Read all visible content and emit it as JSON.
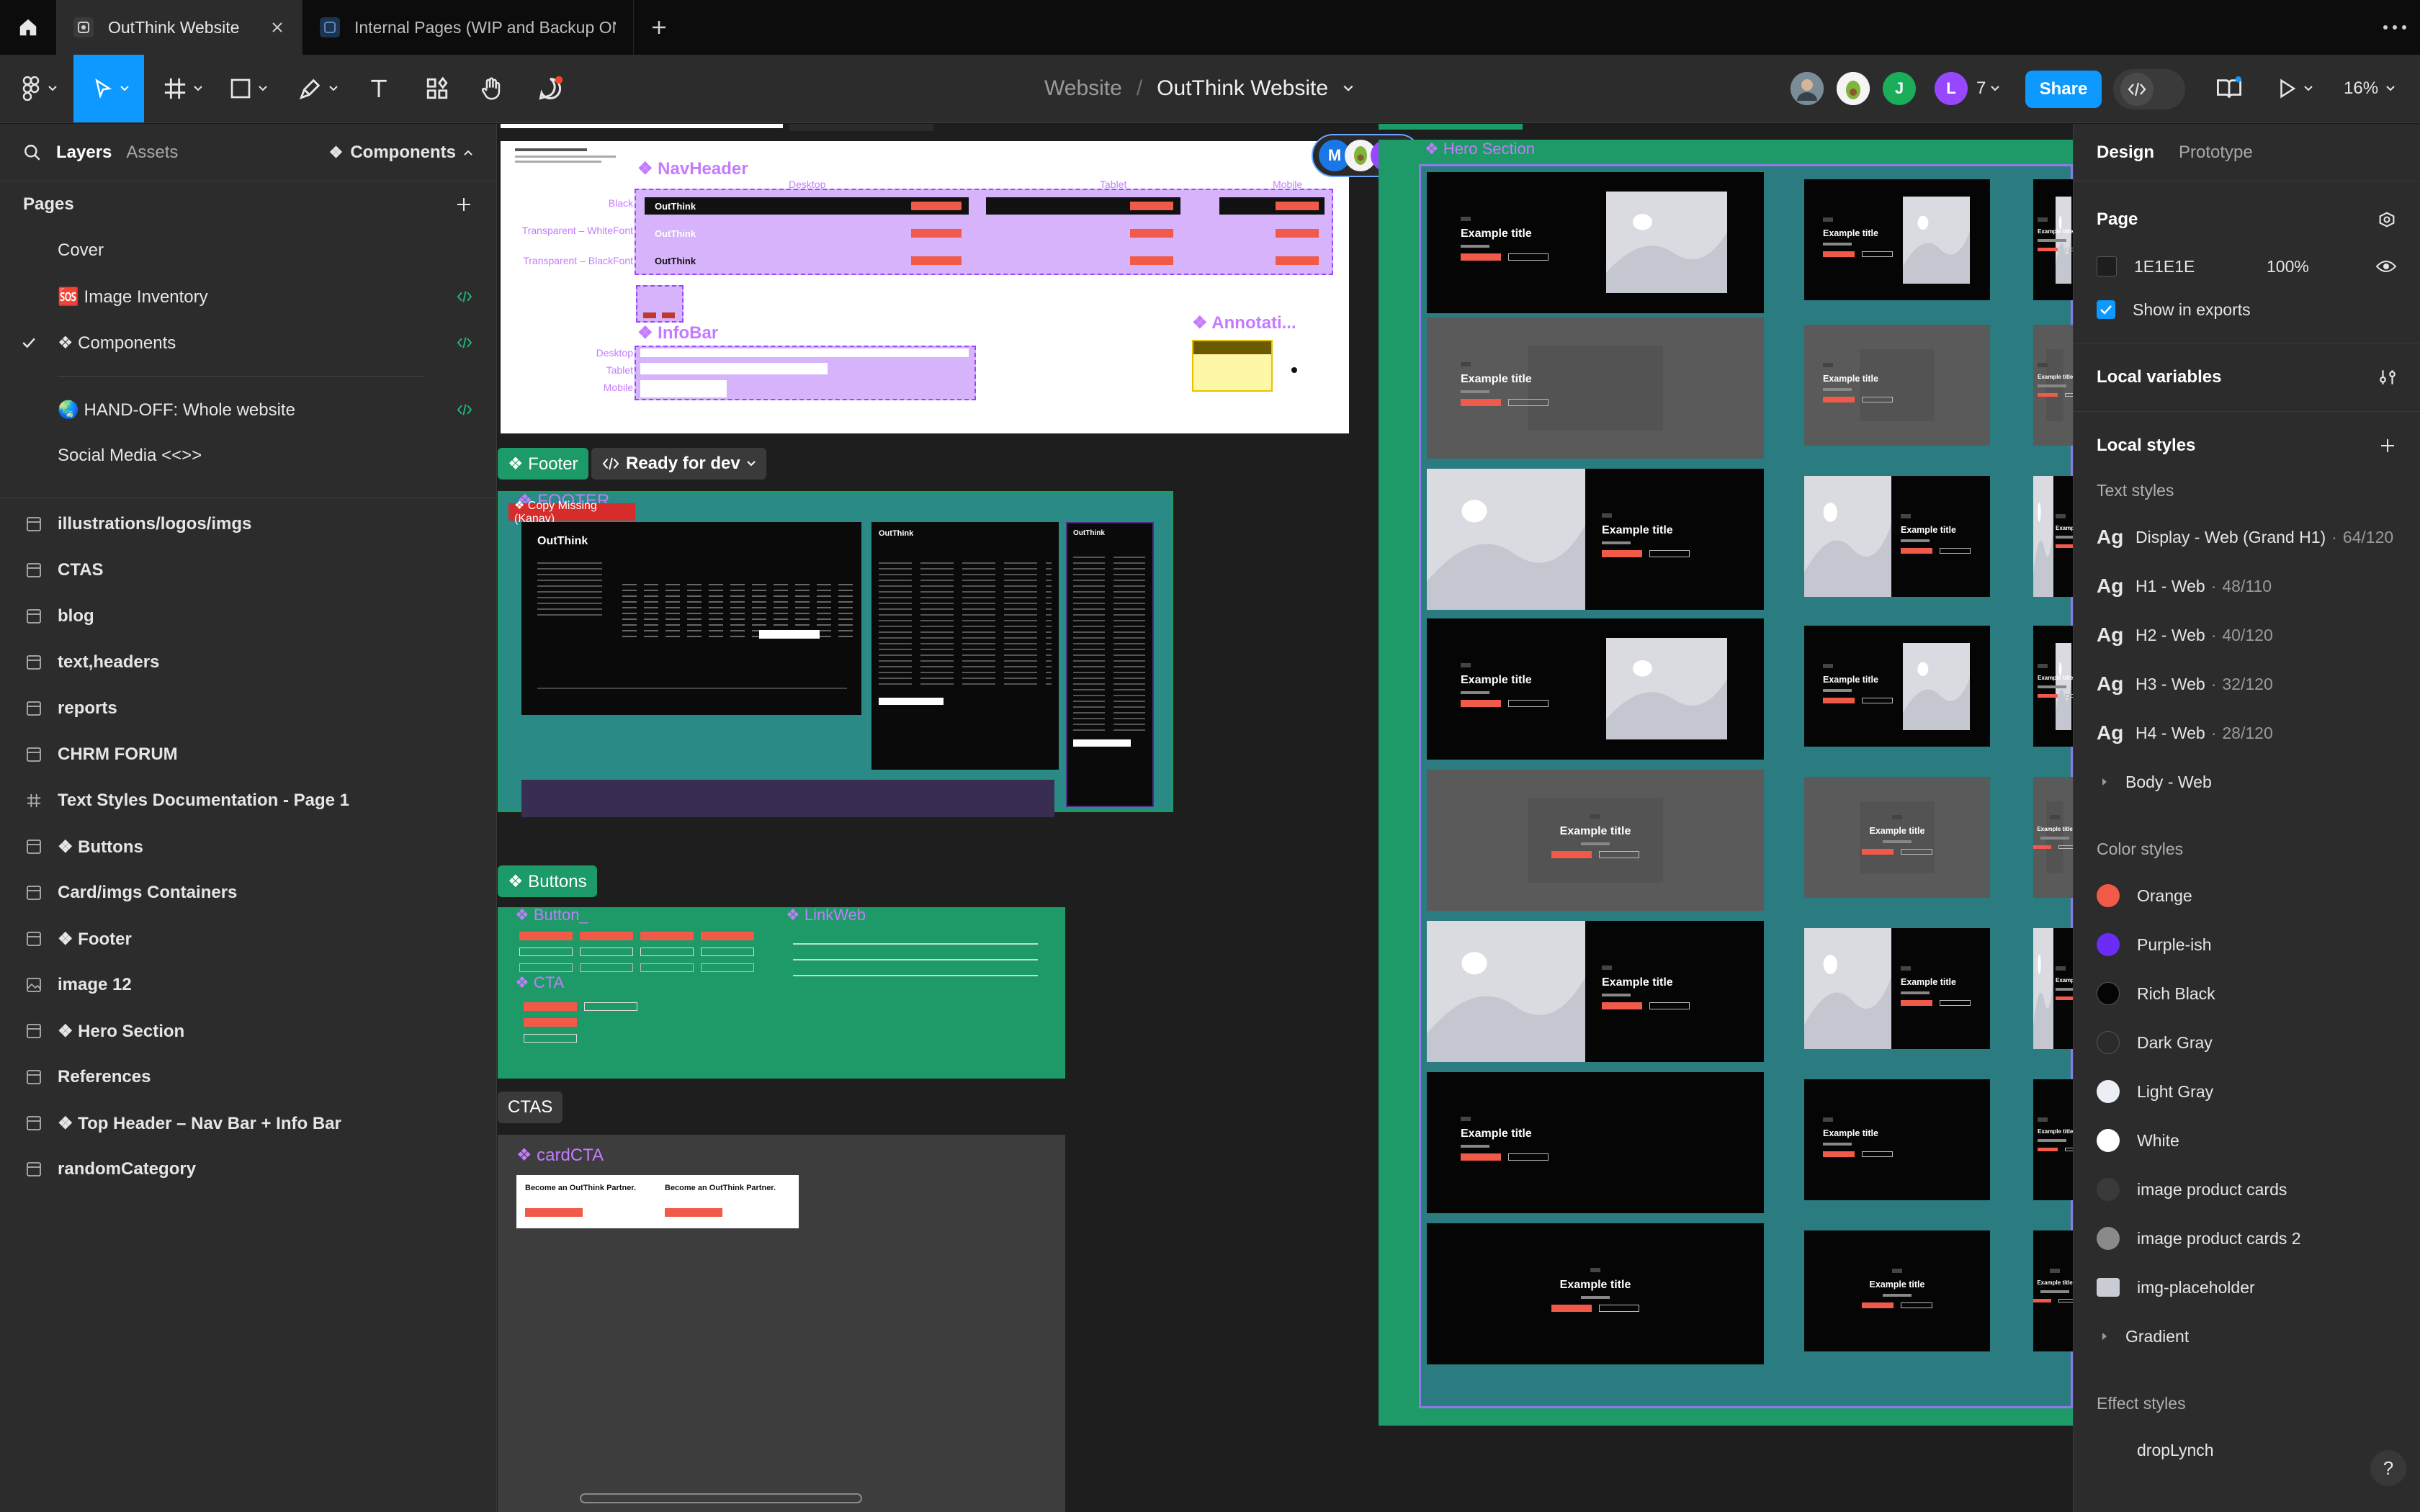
{
  "tabs": [
    {
      "title": "OutThink Website",
      "active": true
    },
    {
      "title": "Internal Pages (WIP and Backup ONL",
      "active": false
    }
  ],
  "toolbar": {
    "project": "Website",
    "separator": "/",
    "file": "OutThink Website",
    "zoom": "16%",
    "share": "Share",
    "avatar_count": "7",
    "avatars": [
      {
        "initial": "J",
        "color": "#1aae5b"
      },
      {
        "initial": "L",
        "color": "#9747ff"
      }
    ]
  },
  "left": {
    "tab_layers": "Layers",
    "tab_assets": "Assets",
    "current_page": "Components",
    "pages_title": "Pages",
    "pages": [
      {
        "label": "Cover",
        "dev": false,
        "current": false
      },
      {
        "label": "🆘 Image Inventory",
        "dev": true,
        "current": false
      },
      {
        "label": "❖ Components",
        "dev": true,
        "current": true
      },
      {
        "label": "🌏 HAND-OFF: Whole website",
        "dev": true,
        "current": false
      },
      {
        "label": "Social Media <<>>",
        "dev": false,
        "current": false
      }
    ],
    "layers": [
      {
        "label": "illustrations/logos/imgs",
        "icon": "frame"
      },
      {
        "label": "CTAS",
        "icon": "frame"
      },
      {
        "label": "blog",
        "icon": "frame"
      },
      {
        "label": "text,headers",
        "icon": "frame"
      },
      {
        "label": "reports",
        "icon": "frame"
      },
      {
        "label": "CHRM FORUM",
        "icon": "frame"
      },
      {
        "label": "Text Styles Documentation - Page 1",
        "icon": "hash"
      },
      {
        "label": "❖ Buttons",
        "icon": "frame"
      },
      {
        "label": "Card/imgs Containers",
        "icon": "frame"
      },
      {
        "label": "❖ Footer",
        "icon": "frame"
      },
      {
        "label": "image 12",
        "icon": "image"
      },
      {
        "label": "❖ Hero Section",
        "icon": "frame"
      },
      {
        "label": "References",
        "icon": "frame"
      },
      {
        "label": "❖ Top Header – Nav Bar + Info Bar",
        "icon": "frame"
      },
      {
        "label": "randomCategory",
        "icon": "frame"
      }
    ]
  },
  "canvas": {
    "navheader": "❖ NavHeader",
    "desktop": "Desktop",
    "tablet": "Tablet",
    "mobile": "Mobile",
    "row_black": "Black",
    "row_white": "Transparent – WhiteFont",
    "row_blackfont": "Transparent – BlackFont",
    "infobar": "❖ InfoBar",
    "annotation": "❖ Annotati...",
    "footer_label": "❖ Footer",
    "ready": "Ready for dev",
    "footer_inner": "❖ FOOTER",
    "copy_missing": "❖ Copy Missing (Kanav)",
    "buttons_label": "❖ Buttons",
    "button_": "❖ Button_",
    "linkweb": "❖ LinkWeb",
    "cta": "❖ CTA",
    "ctas_label": "CTAS",
    "cardcta": "❖ cardCTA",
    "partner": "Become an OutThink Partner.",
    "hero_label": "❖ Hero Section",
    "example_title": "Example title",
    "brand": "OutThink",
    "cursors": [
      {
        "initial": "M",
        "color": "#1a78e6"
      },
      {
        "initial": "L",
        "color": "#9747ff"
      }
    ]
  },
  "right": {
    "tab_design": "Design",
    "tab_prototype": "Prototype",
    "page_title": "Page",
    "page_color": "1E1E1E",
    "page_opacity": "100%",
    "show_exports": "Show in exports",
    "local_variables": "Local variables",
    "local_styles": "Local styles",
    "text_styles_title": "Text styles",
    "text_styles": [
      {
        "name": "Display - Web (Grand H1)",
        "meta": "64/120"
      },
      {
        "name": "H1 - Web",
        "meta": "48/110"
      },
      {
        "name": "H2 - Web",
        "meta": "40/120"
      },
      {
        "name": "H3 - Web",
        "meta": "32/120"
      },
      {
        "name": "H4 - Web",
        "meta": "28/120"
      }
    ],
    "body_group": "Body - Web",
    "color_styles_title": "Color styles",
    "color_styles": [
      {
        "name": "Orange",
        "color": "#f15a48"
      },
      {
        "name": "Purple-ish",
        "color": "#6b2cf5"
      },
      {
        "name": "Rich Black",
        "color": "#050505"
      },
      {
        "name": "Dark Gray",
        "color": "#2b2b2b"
      },
      {
        "name": "Light Gray",
        "color": "#eceef5"
      },
      {
        "name": "White",
        "color": "#ffffff"
      },
      {
        "name": "image product cards",
        "color": "#3a3a3a"
      },
      {
        "name": "image product cards 2",
        "color": "#8a8a8a"
      },
      {
        "name": "img-placeholder",
        "color": "#c9ccd4"
      }
    ],
    "gradient_group": "Gradient",
    "effect_styles_title": "Effect styles",
    "effect_styles": [
      {
        "name": "dropLynch"
      }
    ],
    "help": "?"
  }
}
